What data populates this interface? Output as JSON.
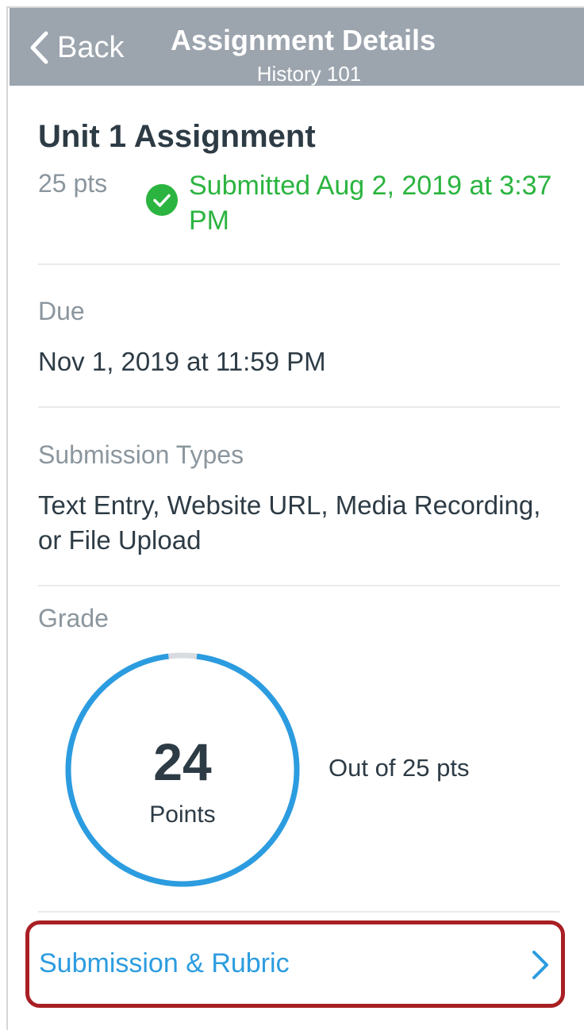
{
  "nav": {
    "back_label": "Back",
    "title": "Assignment Details",
    "subtitle": "History 101"
  },
  "assignment": {
    "title": "Unit 1 Assignment",
    "points": "25 pts",
    "submitted_status": "Submitted Aug 2, 2019 at 3:37 PM"
  },
  "due": {
    "label": "Due",
    "value": "Nov 1, 2019 at 11:59 PM"
  },
  "submission_types": {
    "label": "Submission Types",
    "value": "Text Entry, Website URL, Media Recording, or File Upload"
  },
  "grade": {
    "label": "Grade",
    "score": "24",
    "score_unit": "Points",
    "out_of": "Out of 25 pts",
    "fraction": 0.96
  },
  "rubric_link": {
    "label": "Submission & Rubric"
  },
  "colors": {
    "nav_bg": "#9ca4ae",
    "success_green": "#2bb43f",
    "ring_blue": "#2c9ce0",
    "highlight_red": "#a81f24"
  },
  "icons": {
    "back": "chevron-left-icon",
    "submitted": "check-circle-icon",
    "rubric": "chevron-right-icon"
  }
}
